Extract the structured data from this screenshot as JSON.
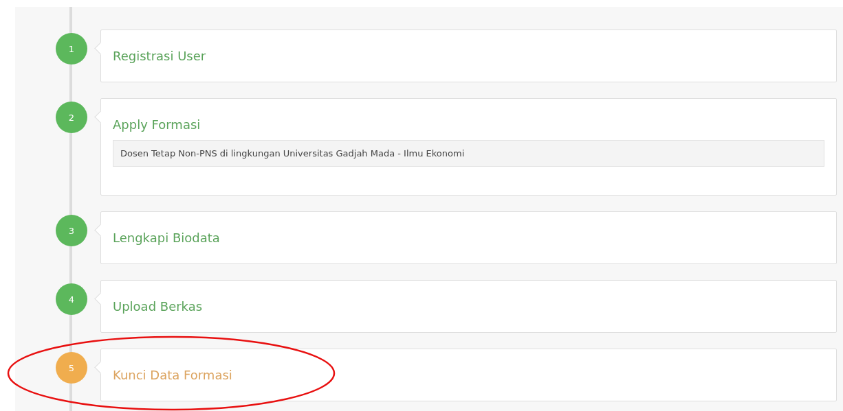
{
  "steps": [
    {
      "number": "1",
      "title": "Registrasi User",
      "current": false,
      "circled": false
    },
    {
      "number": "2",
      "title": "Apply Formasi",
      "current": false,
      "circled": false,
      "detail": "Dosen Tetap Non-PNS di lingkungan Universitas Gadjah Mada - Ilmu Ekonomi"
    },
    {
      "number": "3",
      "title": "Lengkapi Biodata",
      "current": false,
      "circled": false
    },
    {
      "number": "4",
      "title": "Upload Berkas",
      "current": false,
      "circled": false
    },
    {
      "number": "5",
      "title": "Kunci Data Formasi",
      "current": true,
      "circled": true
    }
  ]
}
